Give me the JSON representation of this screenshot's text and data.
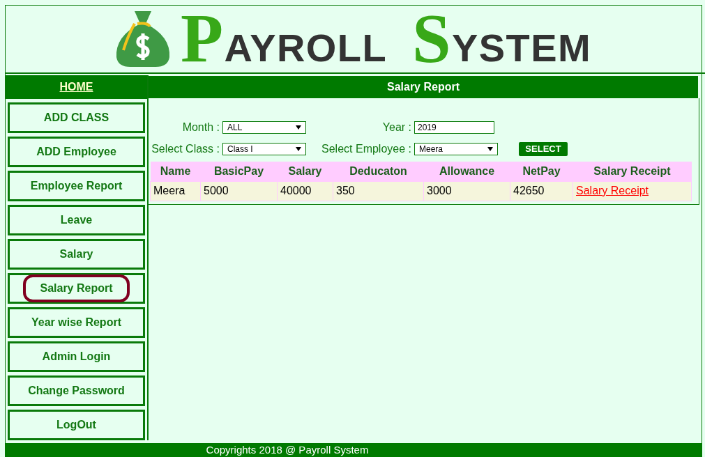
{
  "logo": {
    "words": [
      "PAYROLL",
      "SYSTEM"
    ]
  },
  "sidebar": {
    "home": "HOME",
    "items": [
      {
        "label": "ADD CLASS",
        "selected": false
      },
      {
        "label": "ADD Employee",
        "selected": false
      },
      {
        "label": "Employee Report",
        "selected": false
      },
      {
        "label": "Leave",
        "selected": false
      },
      {
        "label": "Salary",
        "selected": false
      },
      {
        "label": "Salary Report",
        "selected": true
      },
      {
        "label": "Year wise Report",
        "selected": false
      },
      {
        "label": "Admin Login",
        "selected": false
      },
      {
        "label": "Change Password",
        "selected": false
      },
      {
        "label": "LogOut",
        "selected": false
      }
    ]
  },
  "panel": {
    "title": "Salary Report",
    "filters": {
      "month": {
        "label": "Month :",
        "value": "ALL"
      },
      "year": {
        "label": "Year :",
        "value": "2019"
      },
      "class": {
        "label": "Select Class :",
        "value": "Class I"
      },
      "employee": {
        "label": "Select Employee :",
        "value": "Meera"
      },
      "button": "SELECT"
    },
    "table": {
      "columns": [
        "Name",
        "BasicPay",
        "Salary",
        "Deducaton",
        "Allowance",
        "NetPay",
        "Salary Receipt"
      ],
      "rows": [
        {
          "cells": [
            "Meera",
            "5000",
            "40000",
            "350",
            "3000",
            "42650"
          ],
          "link": "Salary Receipt"
        }
      ]
    }
  },
  "footer": "Copyrights 2018 @ Payroll System"
}
